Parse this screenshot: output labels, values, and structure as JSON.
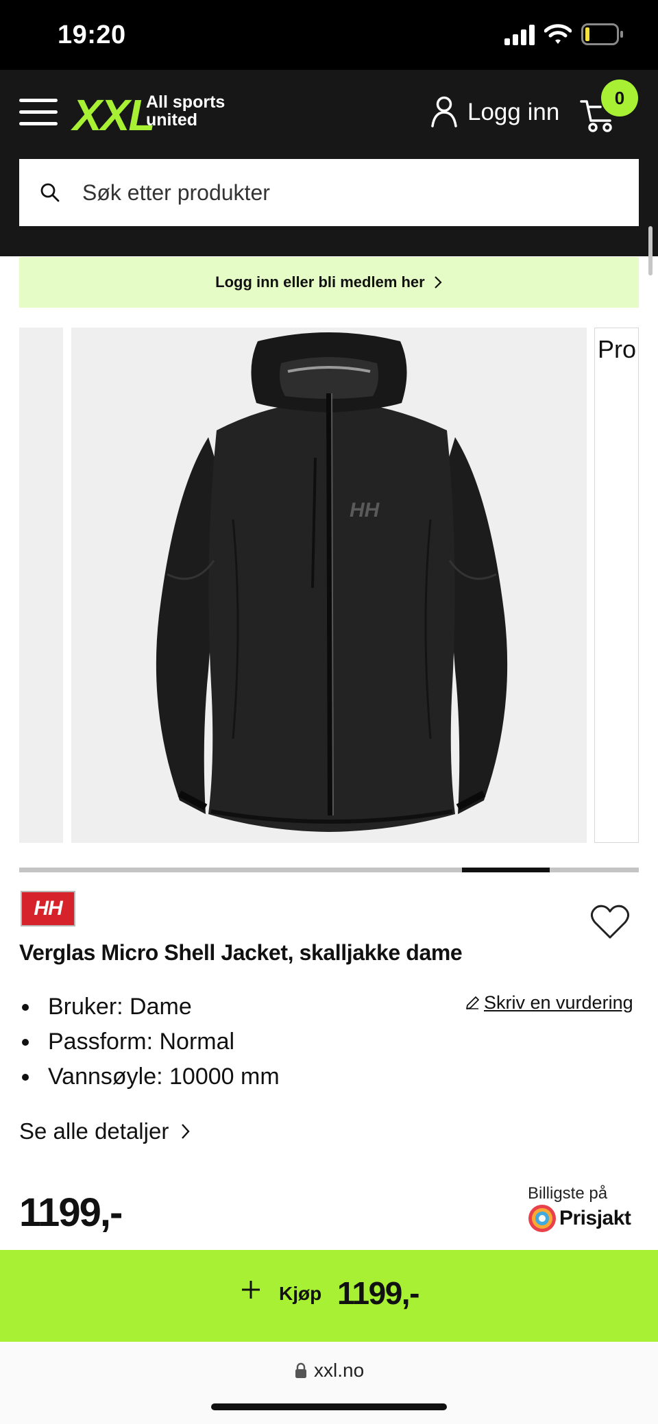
{
  "status_bar": {
    "time": "19:20"
  },
  "header": {
    "logo_text": "XXL",
    "logo_tagline_line1": "All sports",
    "logo_tagline_line2": "united",
    "login_label": "Logg inn",
    "cart_count": "0",
    "search_placeholder": "Søk etter produkter",
    "icons": [
      "hamburger-menu-icon",
      "user-icon",
      "cart-icon",
      "search-icon"
    ]
  },
  "member_banner": {
    "label": "Logg inn eller bli medlem her"
  },
  "gallery": {
    "next_slide_label": "Pro",
    "active_slide": 6,
    "slide_count": 7
  },
  "product": {
    "brand_logo_text": "HH",
    "title": "Verglas Micro Shell Jacket, skalljakke dame",
    "review_link": "Skriv en vurdering",
    "specs": [
      "Bruker: Dame",
      "Passform: Normal",
      "Vannsøyle: 10000 mm"
    ],
    "details_link": "Se alle detaljer",
    "price": "1199,-",
    "prisjakt_caption": "Billigste på",
    "prisjakt_name": "Prisjakt",
    "jacket_logo": "HH"
  },
  "buy_bar": {
    "label": "Kjøp",
    "price": "1199,-"
  },
  "browser": {
    "url": "xxl.no"
  },
  "colors": {
    "accent": "#a8f034",
    "header_bg": "#171717",
    "banner_bg": "#e6fcc6",
    "brand_red": "#d6222b"
  }
}
